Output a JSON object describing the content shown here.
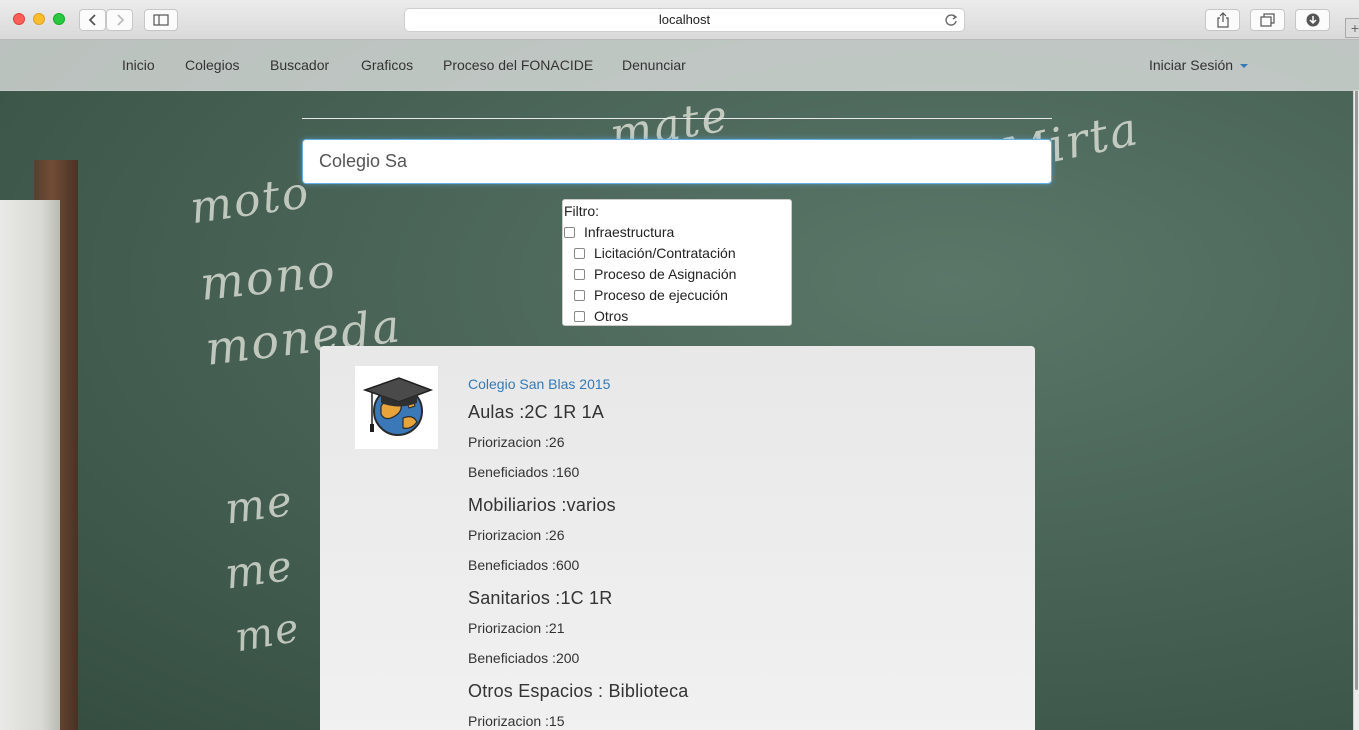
{
  "browser": {
    "url": "localhost"
  },
  "nav": {
    "items": [
      {
        "label": "Inicio"
      },
      {
        "label": "Colegios"
      },
      {
        "label": "Buscador"
      },
      {
        "label": "Graficos"
      },
      {
        "label": "Proceso del FONACIDE"
      },
      {
        "label": "Denunciar"
      }
    ],
    "login": "Iniciar Sesión"
  },
  "search": {
    "value": "Colegio Sa"
  },
  "filter": {
    "title": "Filtro:",
    "options": [
      {
        "label": "Infraestructura",
        "checked": false
      },
      {
        "label": "Licitación/Contratación",
        "checked": false
      },
      {
        "label": "Proceso de Asignación",
        "checked": false
      },
      {
        "label": "Proceso de ejecución",
        "checked": false
      },
      {
        "label": "Otros",
        "checked": false
      }
    ]
  },
  "result": {
    "link": "Colegio San Blas 2015",
    "sections": [
      {
        "title": "Aulas :2C 1R 1A",
        "priorizacion": "Priorizacion :26",
        "beneficiados": "Beneficiados :160"
      },
      {
        "title": "Mobiliarios :varios",
        "priorizacion": "Priorizacion :26",
        "beneficiados": "Beneficiados :600"
      },
      {
        "title": "Sanitarios :1C 1R",
        "priorizacion": "Priorizacion :21",
        "beneficiados": "Beneficiados :200"
      },
      {
        "title": "Otros Espacios : Biblioteca",
        "priorizacion": "Priorizacion :15"
      }
    ]
  },
  "icons": {
    "logo": "graduation-cap-globe-icon",
    "back": "chevron-left-icon",
    "forward": "chevron-right-icon",
    "sidebar": "sidebar-icon",
    "share": "share-icon",
    "tabs": "tabs-icon",
    "download": "download-icon",
    "reload": "reload-icon"
  },
  "colors": {
    "accent": "#337ab7",
    "focus": "#66afe9"
  }
}
